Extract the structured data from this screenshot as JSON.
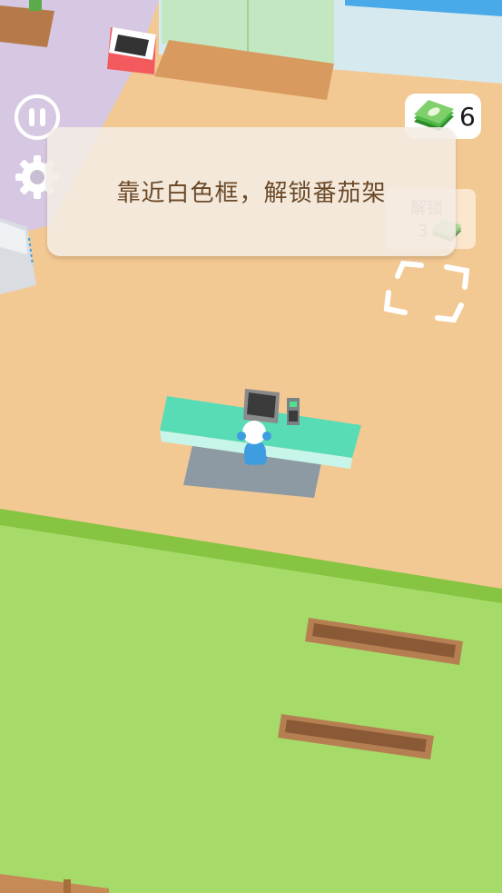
{
  "hud": {
    "pause_icon": "pause-icon",
    "settings_icon": "gear-icon",
    "money_icon": "cash-stack-icon",
    "money_value": "6"
  },
  "tip": {
    "text": "靠近白色框，解锁番茄架"
  },
  "unlock": {
    "label": "解锁",
    "cost": "3",
    "money_icon": "cash-stack-icon"
  },
  "colors": {
    "floor": "#f3c993",
    "grass": "#a6db6a",
    "grass_edge": "#86c441",
    "counter": "#58dcb5",
    "player": "#3e9de0",
    "planter": "#b67f52"
  }
}
